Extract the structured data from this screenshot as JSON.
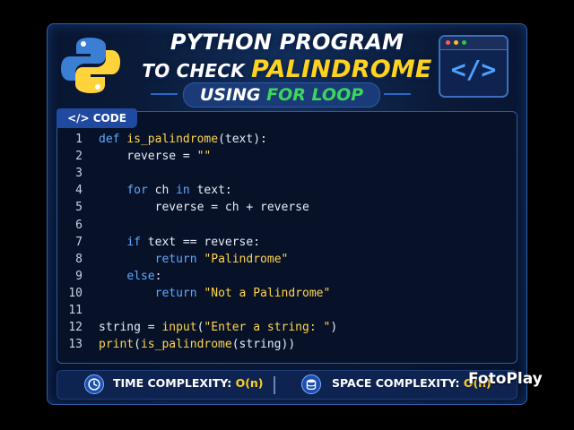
{
  "header": {
    "title_line1": "PYTHON PROGRAM",
    "title_line2_prefix": "TO CHECK",
    "title_line2_highlight": "PALINDROME",
    "subtitle_prefix": "USING",
    "subtitle_highlight": "FOR LOOP"
  },
  "browser_badge": {
    "glyph": "</>"
  },
  "code_panel": {
    "tab_label": "</> CODE",
    "lines": [
      {
        "n": "1",
        "tokens": [
          {
            "t": "def ",
            "c": "kw"
          },
          {
            "t": "is_palindrome",
            "c": "fn"
          },
          {
            "t": "(text):",
            "c": "pl"
          }
        ]
      },
      {
        "n": "2",
        "tokens": [
          {
            "t": "    reverse = ",
            "c": "pl"
          },
          {
            "t": "\"\"",
            "c": "str"
          }
        ]
      },
      {
        "n": "3",
        "tokens": []
      },
      {
        "n": "4",
        "tokens": [
          {
            "t": "    ",
            "c": "pl"
          },
          {
            "t": "for",
            "c": "kw"
          },
          {
            "t": " ch ",
            "c": "pl"
          },
          {
            "t": "in",
            "c": "kw"
          },
          {
            "t": " text:",
            "c": "pl"
          }
        ]
      },
      {
        "n": "5",
        "tokens": [
          {
            "t": "        reverse = ch + reverse",
            "c": "pl"
          }
        ]
      },
      {
        "n": "6",
        "tokens": []
      },
      {
        "n": "7",
        "tokens": [
          {
            "t": "    ",
            "c": "pl"
          },
          {
            "t": "if",
            "c": "kw"
          },
          {
            "t": " text == reverse:",
            "c": "pl"
          }
        ]
      },
      {
        "n": "8",
        "tokens": [
          {
            "t": "        ",
            "c": "pl"
          },
          {
            "t": "return ",
            "c": "kw"
          },
          {
            "t": "\"Palindrome\"",
            "c": "str"
          }
        ]
      },
      {
        "n": "9",
        "tokens": [
          {
            "t": "    ",
            "c": "pl"
          },
          {
            "t": "else",
            "c": "kw"
          },
          {
            "t": ":",
            "c": "pl"
          }
        ]
      },
      {
        "n": "10",
        "tokens": [
          {
            "t": "        ",
            "c": "pl"
          },
          {
            "t": "return ",
            "c": "kw"
          },
          {
            "t": "\"Not a Palindrome\"",
            "c": "str"
          }
        ]
      },
      {
        "n": "11",
        "tokens": []
      },
      {
        "n": "12",
        "tokens": [
          {
            "t": "string = ",
            "c": "pl"
          },
          {
            "t": "input",
            "c": "fn"
          },
          {
            "t": "(",
            "c": "pl"
          },
          {
            "t": "\"Enter a string: \"",
            "c": "str"
          },
          {
            "t": ")",
            "c": "pl"
          }
        ]
      },
      {
        "n": "13",
        "tokens": [
          {
            "t": "print",
            "c": "fn"
          },
          {
            "t": "(",
            "c": "pl"
          },
          {
            "t": "is_palindrome",
            "c": "fn"
          },
          {
            "t": "(string))",
            "c": "pl"
          }
        ]
      }
    ]
  },
  "footer": {
    "time_label": "TIME COMPLEXITY:",
    "time_value": "O(n)",
    "space_label": "SPACE COMPLEXITY:",
    "space_value": "O(n)",
    "time_icon": "clock-icon",
    "space_icon": "database-icon"
  },
  "watermark": "FotoPlay",
  "colors": {
    "keyword": "#5fa8ff",
    "function": "#ffd54a",
    "string": "#ffd54a",
    "highlight_yellow": "#ffd21f",
    "highlight_green": "#39d85a"
  }
}
